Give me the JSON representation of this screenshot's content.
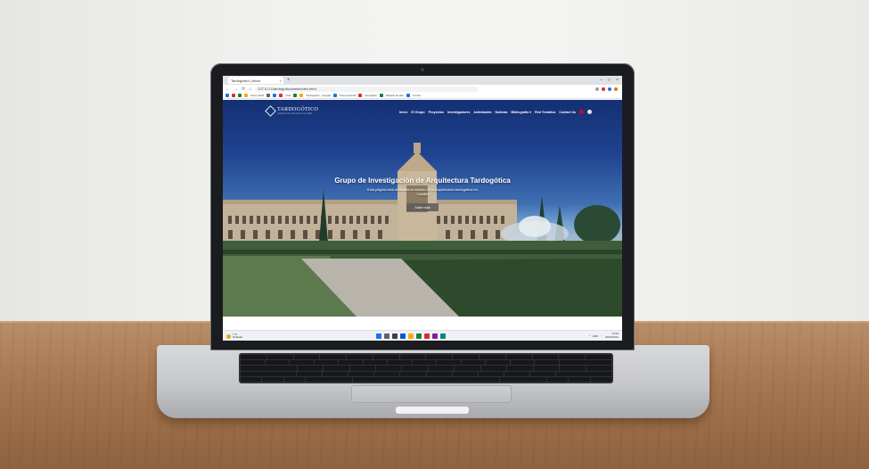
{
  "browser": {
    "tab_title": "Tardogótico | Inicio",
    "new_tab": "+",
    "tab_close": "×",
    "window_controls": [
      "–",
      "□",
      "×"
    ],
    "url": "127.0.0.1/tardogotico/web/index.html",
    "nav_icons": [
      "back-arrow-icon",
      "forward-arrow-icon",
      "reload-icon",
      "home-icon"
    ],
    "bookmarks": [
      "Zoom 2024",
      "UVA",
      "Tardogótico - Google",
      "Tesis doctoral",
      "Geografía",
      "Historia de arte",
      "Correo"
    ]
  },
  "site": {
    "logo": "TARDOGÓTICO",
    "logo_sub": "GRUPO DE INVESTIGACIÓN",
    "menu": [
      "Inicio",
      "El Grupo",
      "Proyectos",
      "Investigadores",
      "Actividades",
      "Noticias",
      "Bibliografía ▾",
      "Red Temática",
      "Contact Us"
    ],
    "hero_title": "Grupo de Investigación de Arquitectura Tardogótica",
    "hero_subtitle_line1": "Esta página está dedicada al estudio de la arquitectura tardogótica en",
    "hero_subtitle_line2": "Castilla",
    "hero_button": "Saber más"
  },
  "taskbar": {
    "weather_temp": "7°C",
    "weather_desc": "Nublado",
    "time": "13:24",
    "date": "20/02/2024",
    "tray_lang": "ESP"
  },
  "colors": {
    "accent_blue": "#1f4390",
    "wall": "#f2f2f0",
    "table": "#a5764f"
  }
}
